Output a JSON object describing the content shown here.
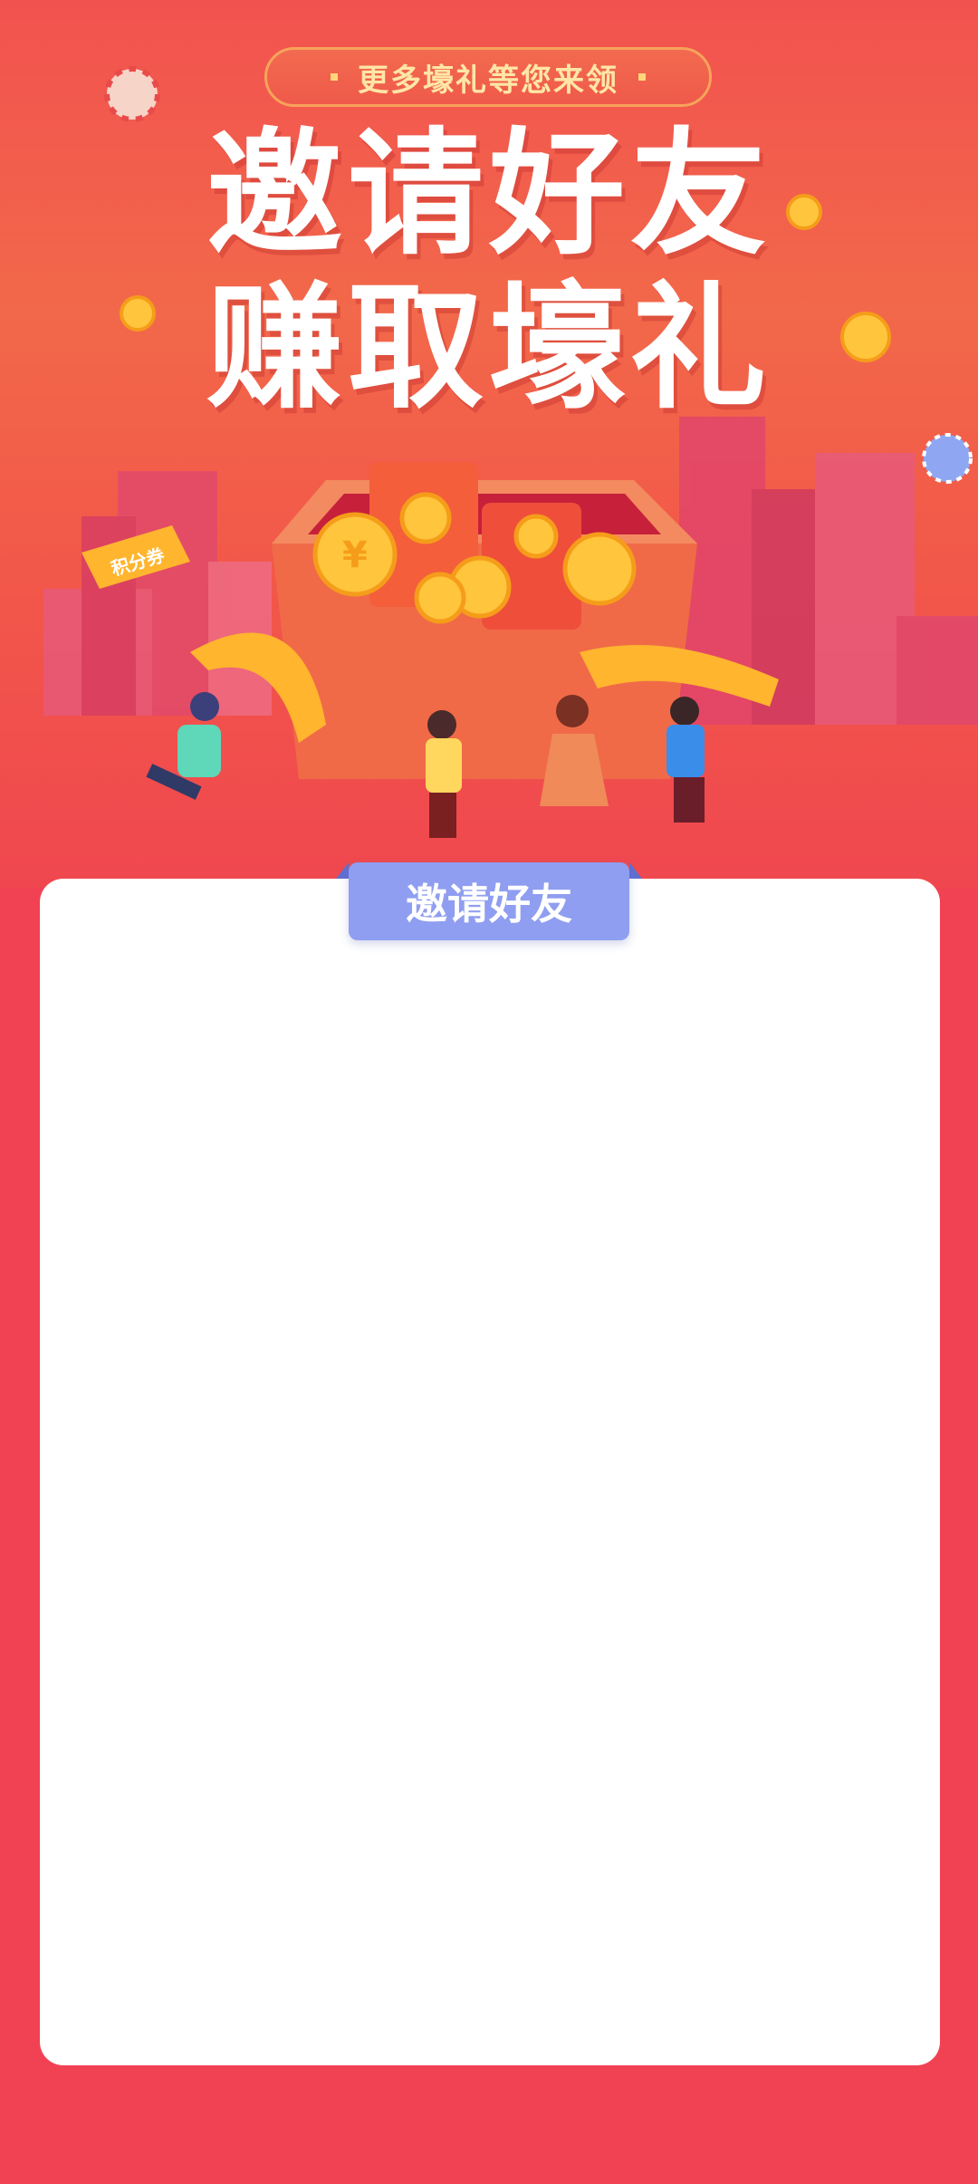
{
  "banner": {
    "tagline": "更多壕礼等您来领",
    "headline_line1": "邀请好友",
    "headline_line2": "赚取壕礼",
    "coupon_label": "积分券",
    "coin_symbol": "¥"
  },
  "card": {
    "tab_label": "邀请好友"
  },
  "colors": {
    "background": "#f14253",
    "tab": "#8f9ef0",
    "tagline_text": "#ffe6a6"
  }
}
